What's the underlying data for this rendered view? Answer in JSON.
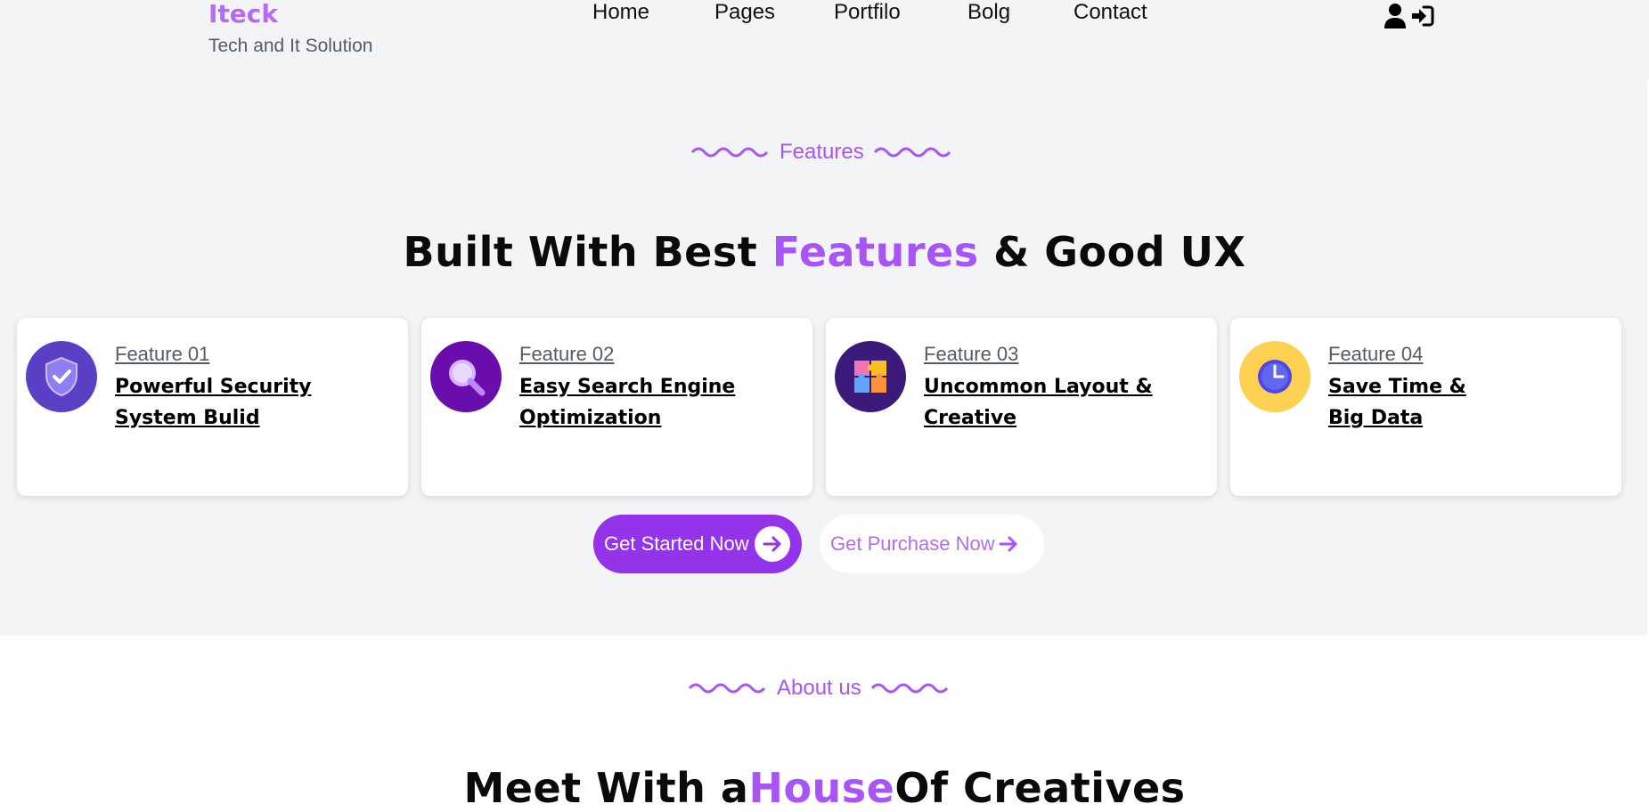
{
  "brand": {
    "name": "Iteck",
    "tagline": "Tech and It Solution"
  },
  "nav": {
    "home": "Home",
    "pages": "Pages",
    "portfolio": "Portfilo",
    "blog": "Bolg",
    "contact": "Contact"
  },
  "header_icons": [
    "user-icon",
    "login-icon"
  ],
  "features_section": {
    "label": "Features",
    "heading_before": "Built With Best ",
    "heading_highlight": "Features",
    "heading_after": " & Good UX",
    "cards": [
      {
        "number": "Feature 01",
        "title": "Powerful Security System Bulid",
        "icon": "shield-check-icon",
        "circle_color": "#5b3fc4"
      },
      {
        "number": "Feature 02",
        "title": "Easy Search Engine Optimization",
        "icon": "magnifier-icon",
        "circle_color": "#6a0dad"
      },
      {
        "number": "Feature 03",
        "title": "Uncommon Layout & Creative",
        "icon": "puzzle-icon",
        "circle_color": "#3b1a7a"
      },
      {
        "number": "Feature 04",
        "title": "Save Time & Big Data",
        "icon": "clock-icon",
        "circle_color": "#ffd152"
      }
    ],
    "primary_button": "Get Started Now",
    "secondary_button": "Get Purchase Now"
  },
  "about_section": {
    "label": "About us",
    "heading_before": "Meet With a",
    "heading_highlight": "House",
    "heading_after": "Of Creatives"
  },
  "colors": {
    "accent": "#a855f7",
    "primary_button": "#9333ea",
    "band_background": "#f3f4f6"
  }
}
